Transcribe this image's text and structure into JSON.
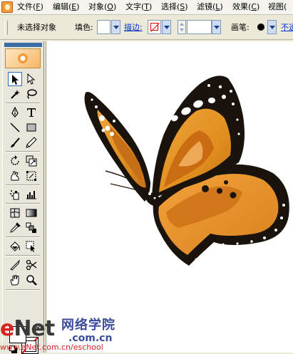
{
  "menu": {
    "items": [
      {
        "label": "文件(",
        "key": "F",
        "tail": ")"
      },
      {
        "label": "编辑(",
        "key": "E",
        "tail": ")"
      },
      {
        "label": "对象(",
        "key": "O",
        "tail": ")"
      },
      {
        "label": "文字(",
        "key": "T",
        "tail": ")"
      },
      {
        "label": "选择(",
        "key": "S",
        "tail": ")"
      },
      {
        "label": "滤镜(",
        "key": "L",
        "tail": ")"
      },
      {
        "label": "效果(",
        "key": "C",
        "tail": ")"
      },
      {
        "label": "视图(",
        "key": "",
        "tail": ""
      }
    ]
  },
  "controlbar": {
    "status": "未选择对象",
    "fill_label": "填色:",
    "stroke_label": "描边:",
    "brush_label": "画笔:",
    "opacity_label": "不透"
  },
  "toolbox": {
    "fill_color": "#ffffff",
    "stroke": "none"
  },
  "watermark": {
    "logo_e": "e",
    "logo_rest": "Net",
    "cn": "网络学院",
    "domain": ".com.cn",
    "url": "www.eNet.com.cn/eschool"
  },
  "colors": {
    "wing_orange": "#e08f1e",
    "wing_black": "#1a130c",
    "accent_red": "#d82222"
  }
}
